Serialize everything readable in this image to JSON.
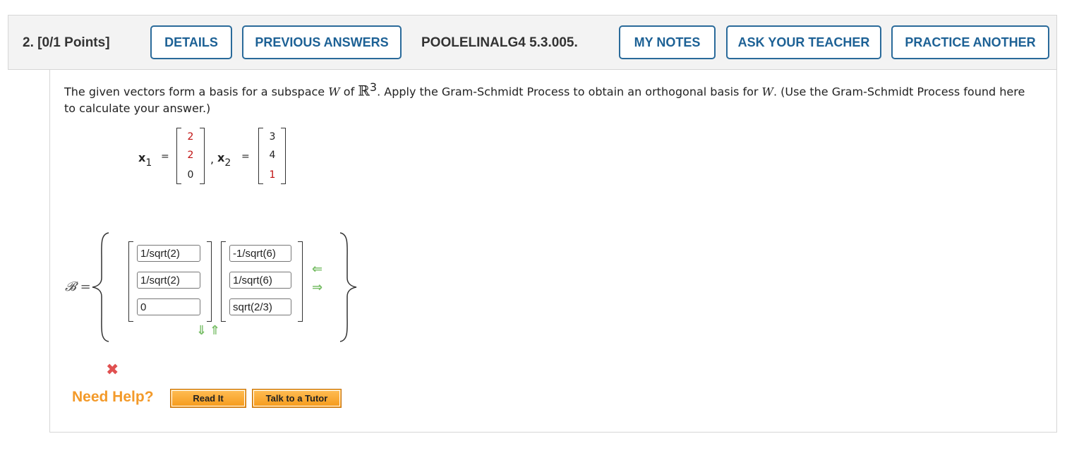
{
  "header": {
    "question_label": "2.  [0/1 Points]",
    "details": "DETAILS",
    "previous_answers": "PREVIOUS ANSWERS",
    "problem_code": "POOLELINALG4 5.3.005.",
    "my_notes": "MY NOTES",
    "ask_teacher": "ASK YOUR TEACHER",
    "practice_another": "PRACTICE ANOTHER"
  },
  "problem": {
    "text_1": "The given vectors form a basis for a subspace ",
    "W": "W",
    "text_of": " of ",
    "R": "ℝ",
    "exp": "3",
    "text_2": ". Apply the Gram-Schmidt Process to obtain an orthogonal basis for ",
    "W2": "W",
    "text_3": ". (Use the Gram-Schmidt Process found here to calculate your answer.)",
    "x1_label": "x",
    "x1_sub": "1",
    "x2_label": "x",
    "x2_sub": "2",
    "equals": "=",
    "comma": ",",
    "x1": [
      "2",
      "2",
      "0"
    ],
    "x2": [
      "3",
      "4",
      "1"
    ]
  },
  "answer": {
    "basis_label": "𝓑 =",
    "col1": [
      "1/sqrt(2)",
      "1/sqrt(2)",
      "0"
    ],
    "col2": [
      "-1/sqrt(6)",
      "1/sqrt(6)",
      "sqrt(2/3)"
    ]
  },
  "help": {
    "need_help": "Need Help?",
    "read_it": "Read It",
    "talk_tutor": "Talk to a Tutor"
  },
  "colors": {
    "link_blue": "#1d6195",
    "highlight_red": "#c01010",
    "help_orange": "#f39a2a",
    "arrow_green": "#7bbf6a"
  }
}
